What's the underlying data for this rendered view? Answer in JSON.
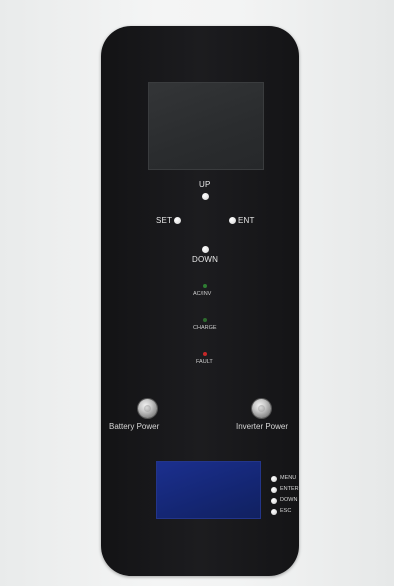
{
  "panel": {
    "nav": {
      "up_label": "UP",
      "set_label": "SET",
      "ent_label": "ENT",
      "down_label": "DOWN"
    },
    "indicators": [
      {
        "label": "AC/INV",
        "color": "#2e7d32"
      },
      {
        "label": "CHARGE",
        "color": "#2e6b2e"
      },
      {
        "label": "FAULT",
        "color": "#c62828"
      }
    ],
    "switches": {
      "battery_label": "Battery Power",
      "inverter_label": "Inverter Power"
    },
    "bms": {
      "menu_label": "MENU",
      "enter_label": "ENTER",
      "down_label": "DOWN",
      "esc_label": "ESC"
    }
  },
  "colors": {
    "panel": "#1a1a1c",
    "lcd_top": "#2c2e30",
    "lcd_bottom": "#17297a"
  }
}
